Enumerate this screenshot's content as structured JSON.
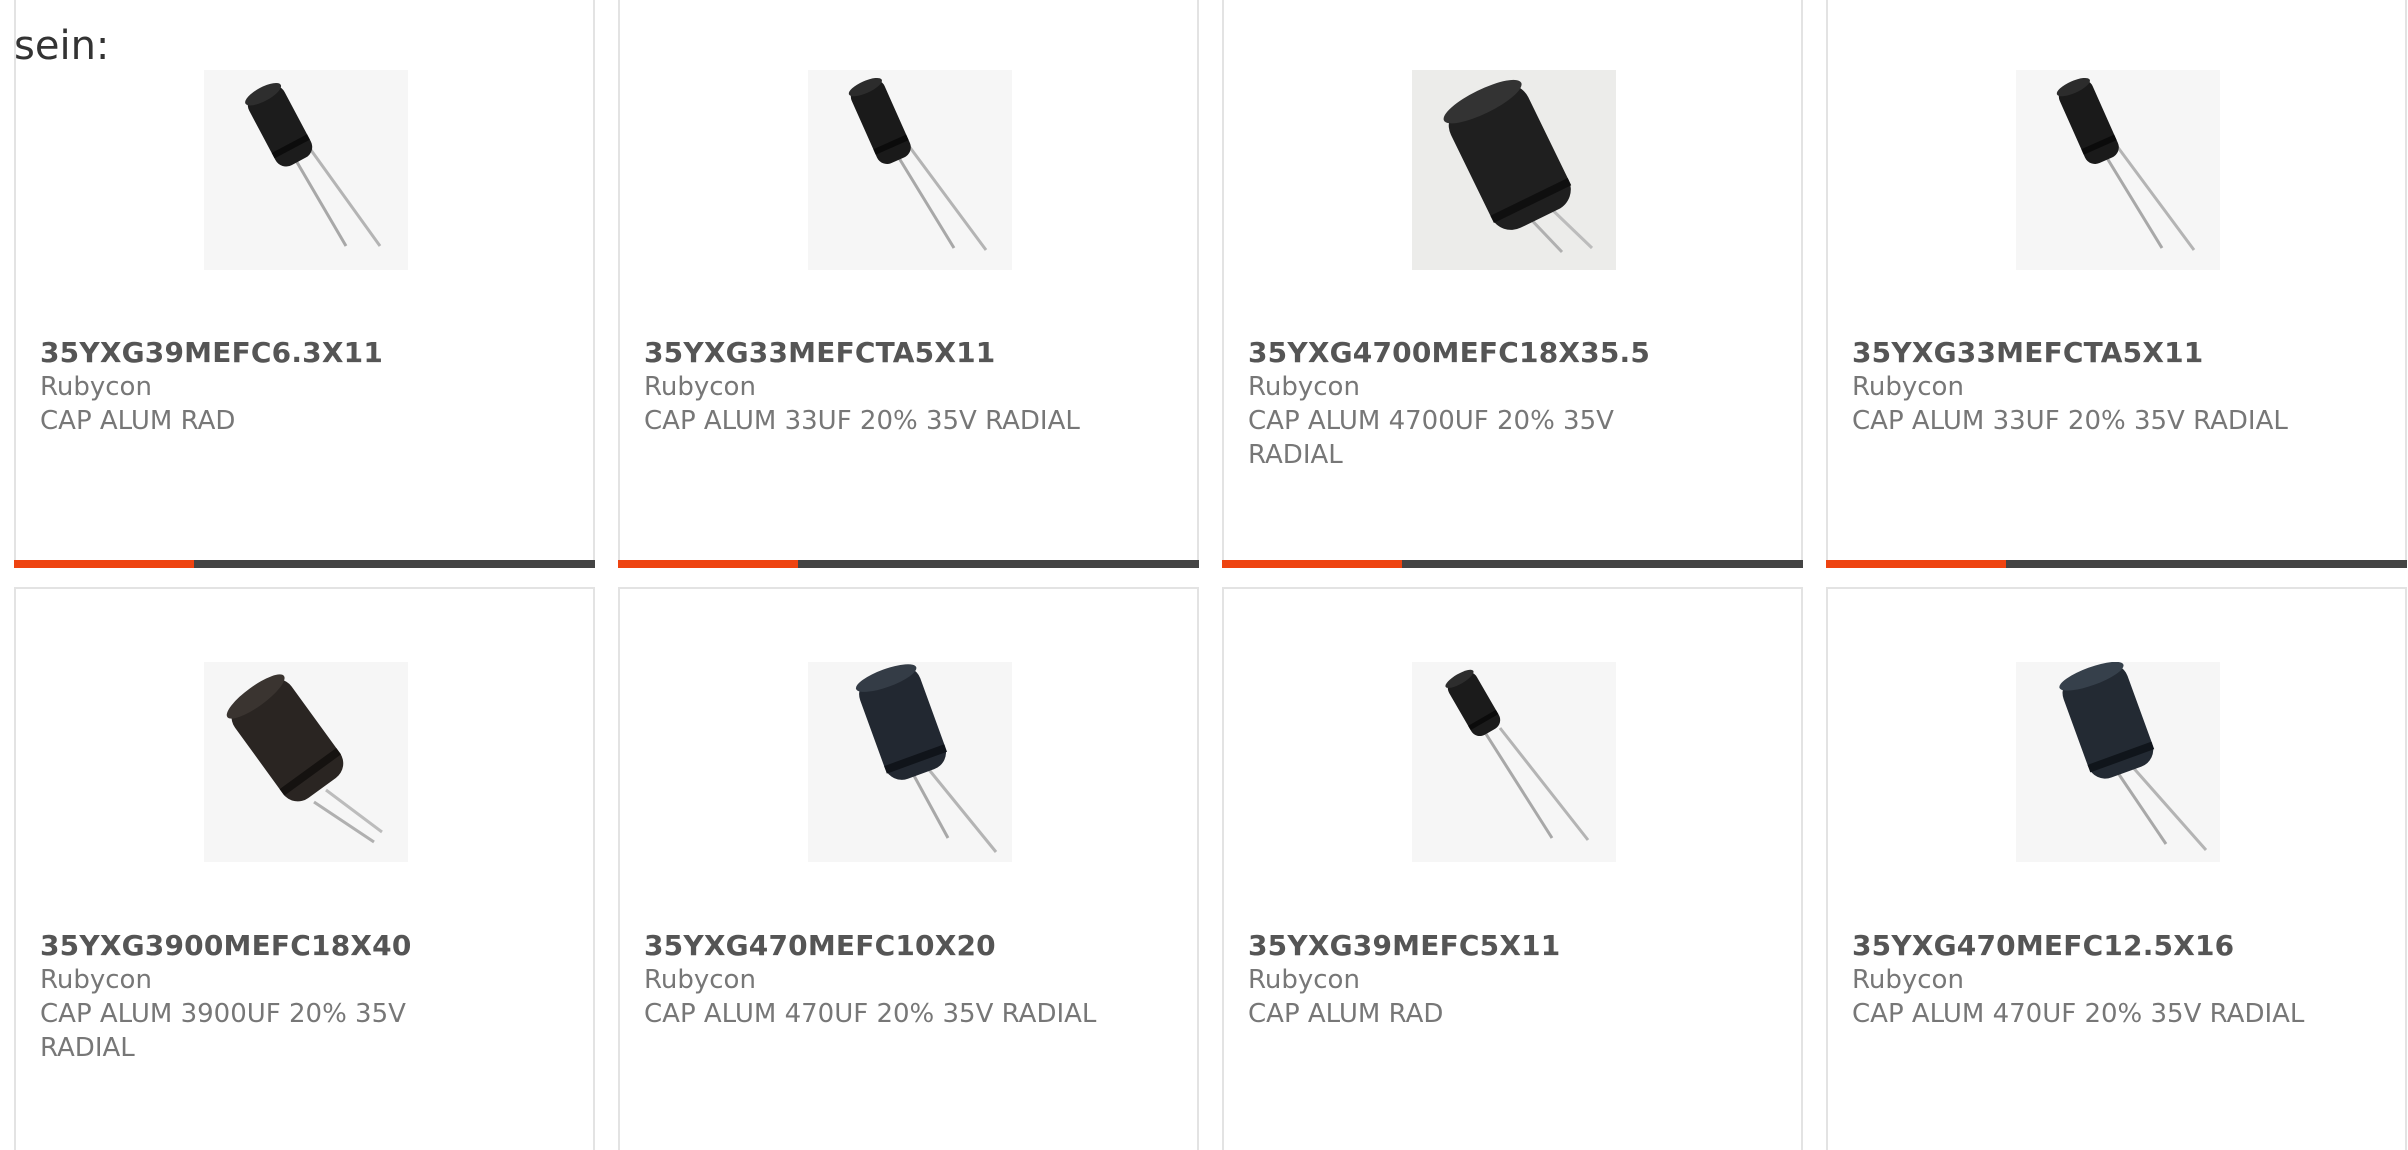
{
  "intro_text": "sein:",
  "colors": {
    "accent": "#ee4411",
    "bar_track": "#444444",
    "card_border": "#e3e3e3",
    "title_text": "#555555",
    "body_text": "#777777"
  },
  "products": [
    {
      "part_number": "35YXG39MEFC6.3X11",
      "manufacturer": "Rubycon",
      "description": "CAP ALUM RAD",
      "image_icon": "capacitor-radial-small-icon",
      "carousel_progress": 0.31
    },
    {
      "part_number": "35YXG33MEFCTA5X11",
      "manufacturer": "Rubycon",
      "description": "CAP ALUM 33UF 20% 35V RADIAL",
      "image_icon": "capacitor-radial-small-icon",
      "carousel_progress": 0.31
    },
    {
      "part_number": "35YXG4700MEFC18X35.5",
      "manufacturer": "Rubycon",
      "description": "CAP ALUM 4700UF 20% 35V RADIAL",
      "image_icon": "capacitor-radial-large-icon",
      "carousel_progress": 0.31
    },
    {
      "part_number": "35YXG33MEFCTA5X11",
      "manufacturer": "Rubycon",
      "description": "CAP ALUM 33UF 20% 35V RADIAL",
      "image_icon": "capacitor-radial-small-icon",
      "carousel_progress": 0.31
    },
    {
      "part_number": "35YXG3900MEFC18X40",
      "manufacturer": "Rubycon",
      "description": "CAP ALUM 3900UF 20% 35V RADIAL",
      "image_icon": "capacitor-radial-large-icon"
    },
    {
      "part_number": "35YXG470MEFC10X20",
      "manufacturer": "Rubycon",
      "description": "CAP ALUM 470UF 20% 35V RADIAL",
      "image_icon": "capacitor-radial-medium-icon"
    },
    {
      "part_number": "35YXG39MEFC5X11",
      "manufacturer": "Rubycon",
      "description": "CAP ALUM RAD",
      "image_icon": "capacitor-radial-small-icon"
    },
    {
      "part_number": "35YXG470MEFC12.5X16",
      "manufacturer": "Rubycon",
      "description": "CAP ALUM 470UF 20% 35V RADIAL",
      "image_icon": "capacitor-radial-medium-icon"
    }
  ]
}
